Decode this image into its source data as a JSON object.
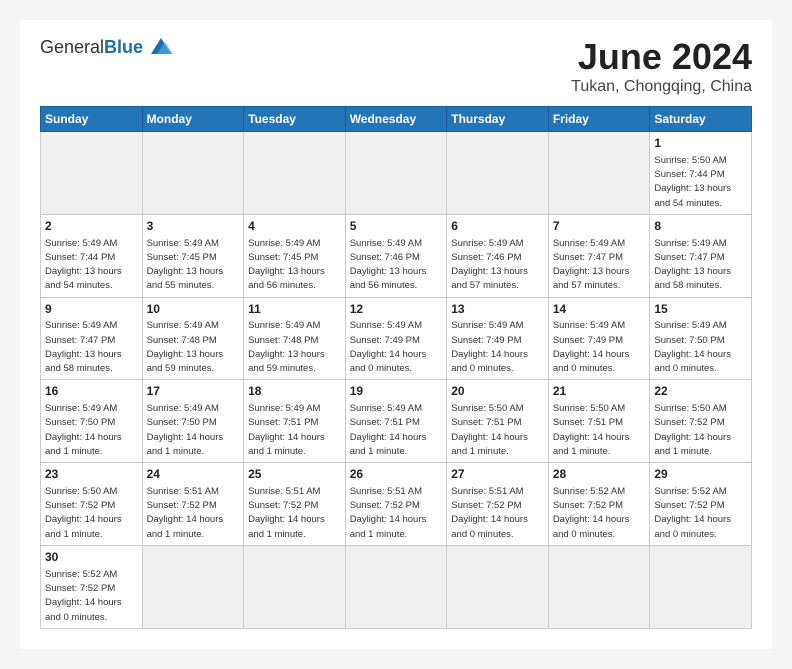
{
  "header": {
    "logo_general": "General",
    "logo_blue": "Blue",
    "title": "June 2024",
    "location": "Tukan, Chongqing, China"
  },
  "days_of_week": [
    "Sunday",
    "Monday",
    "Tuesday",
    "Wednesday",
    "Thursday",
    "Friday",
    "Saturday"
  ],
  "weeks": [
    [
      {
        "day": "",
        "empty": true
      },
      {
        "day": "",
        "empty": true
      },
      {
        "day": "",
        "empty": true
      },
      {
        "day": "",
        "empty": true
      },
      {
        "day": "",
        "empty": true
      },
      {
        "day": "",
        "empty": true
      },
      {
        "day": "1",
        "sunrise": "Sunrise: 5:50 AM",
        "sunset": "Sunset: 7:44 PM",
        "daylight": "Daylight: 13 hours and 54 minutes."
      }
    ],
    [
      {
        "day": "2",
        "sunrise": "Sunrise: 5:49 AM",
        "sunset": "Sunset: 7:44 PM",
        "daylight": "Daylight: 13 hours and 54 minutes."
      },
      {
        "day": "3",
        "sunrise": "Sunrise: 5:49 AM",
        "sunset": "Sunset: 7:45 PM",
        "daylight": "Daylight: 13 hours and 55 minutes."
      },
      {
        "day": "4",
        "sunrise": "Sunrise: 5:49 AM",
        "sunset": "Sunset: 7:45 PM",
        "daylight": "Daylight: 13 hours and 56 minutes."
      },
      {
        "day": "5",
        "sunrise": "Sunrise: 5:49 AM",
        "sunset": "Sunset: 7:46 PM",
        "daylight": "Daylight: 13 hours and 56 minutes."
      },
      {
        "day": "6",
        "sunrise": "Sunrise: 5:49 AM",
        "sunset": "Sunset: 7:46 PM",
        "daylight": "Daylight: 13 hours and 57 minutes."
      },
      {
        "day": "7",
        "sunrise": "Sunrise: 5:49 AM",
        "sunset": "Sunset: 7:47 PM",
        "daylight": "Daylight: 13 hours and 57 minutes."
      },
      {
        "day": "8",
        "sunrise": "Sunrise: 5:49 AM",
        "sunset": "Sunset: 7:47 PM",
        "daylight": "Daylight: 13 hours and 58 minutes."
      }
    ],
    [
      {
        "day": "9",
        "sunrise": "Sunrise: 5:49 AM",
        "sunset": "Sunset: 7:47 PM",
        "daylight": "Daylight: 13 hours and 58 minutes."
      },
      {
        "day": "10",
        "sunrise": "Sunrise: 5:49 AM",
        "sunset": "Sunset: 7:48 PM",
        "daylight": "Daylight: 13 hours and 59 minutes."
      },
      {
        "day": "11",
        "sunrise": "Sunrise: 5:49 AM",
        "sunset": "Sunset: 7:48 PM",
        "daylight": "Daylight: 13 hours and 59 minutes."
      },
      {
        "day": "12",
        "sunrise": "Sunrise: 5:49 AM",
        "sunset": "Sunset: 7:49 PM",
        "daylight": "Daylight: 14 hours and 0 minutes."
      },
      {
        "day": "13",
        "sunrise": "Sunrise: 5:49 AM",
        "sunset": "Sunset: 7:49 PM",
        "daylight": "Daylight: 14 hours and 0 minutes."
      },
      {
        "day": "14",
        "sunrise": "Sunrise: 5:49 AM",
        "sunset": "Sunset: 7:49 PM",
        "daylight": "Daylight: 14 hours and 0 minutes."
      },
      {
        "day": "15",
        "sunrise": "Sunrise: 5:49 AM",
        "sunset": "Sunset: 7:50 PM",
        "daylight": "Daylight: 14 hours and 0 minutes."
      }
    ],
    [
      {
        "day": "16",
        "sunrise": "Sunrise: 5:49 AM",
        "sunset": "Sunset: 7:50 PM",
        "daylight": "Daylight: 14 hours and 1 minute."
      },
      {
        "day": "17",
        "sunrise": "Sunrise: 5:49 AM",
        "sunset": "Sunset: 7:50 PM",
        "daylight": "Daylight: 14 hours and 1 minute."
      },
      {
        "day": "18",
        "sunrise": "Sunrise: 5:49 AM",
        "sunset": "Sunset: 7:51 PM",
        "daylight": "Daylight: 14 hours and 1 minute."
      },
      {
        "day": "19",
        "sunrise": "Sunrise: 5:49 AM",
        "sunset": "Sunset: 7:51 PM",
        "daylight": "Daylight: 14 hours and 1 minute."
      },
      {
        "day": "20",
        "sunrise": "Sunrise: 5:50 AM",
        "sunset": "Sunset: 7:51 PM",
        "daylight": "Daylight: 14 hours and 1 minute."
      },
      {
        "day": "21",
        "sunrise": "Sunrise: 5:50 AM",
        "sunset": "Sunset: 7:51 PM",
        "daylight": "Daylight: 14 hours and 1 minute."
      },
      {
        "day": "22",
        "sunrise": "Sunrise: 5:50 AM",
        "sunset": "Sunset: 7:52 PM",
        "daylight": "Daylight: 14 hours and 1 minute."
      }
    ],
    [
      {
        "day": "23",
        "sunrise": "Sunrise: 5:50 AM",
        "sunset": "Sunset: 7:52 PM",
        "daylight": "Daylight: 14 hours and 1 minute."
      },
      {
        "day": "24",
        "sunrise": "Sunrise: 5:51 AM",
        "sunset": "Sunset: 7:52 PM",
        "daylight": "Daylight: 14 hours and 1 minute."
      },
      {
        "day": "25",
        "sunrise": "Sunrise: 5:51 AM",
        "sunset": "Sunset: 7:52 PM",
        "daylight": "Daylight: 14 hours and 1 minute."
      },
      {
        "day": "26",
        "sunrise": "Sunrise: 5:51 AM",
        "sunset": "Sunset: 7:52 PM",
        "daylight": "Daylight: 14 hours and 1 minute."
      },
      {
        "day": "27",
        "sunrise": "Sunrise: 5:51 AM",
        "sunset": "Sunset: 7:52 PM",
        "daylight": "Daylight: 14 hours and 0 minutes."
      },
      {
        "day": "28",
        "sunrise": "Sunrise: 5:52 AM",
        "sunset": "Sunset: 7:52 PM",
        "daylight": "Daylight: 14 hours and 0 minutes."
      },
      {
        "day": "29",
        "sunrise": "Sunrise: 5:52 AM",
        "sunset": "Sunset: 7:52 PM",
        "daylight": "Daylight: 14 hours and 0 minutes."
      }
    ],
    [
      {
        "day": "30",
        "sunrise": "Sunrise: 5:52 AM",
        "sunset": "Sunset: 7:52 PM",
        "daylight": "Daylight: 14 hours and 0 minutes."
      },
      {
        "day": "",
        "empty": true
      },
      {
        "day": "",
        "empty": true
      },
      {
        "day": "",
        "empty": true
      },
      {
        "day": "",
        "empty": true
      },
      {
        "day": "",
        "empty": true
      },
      {
        "day": "",
        "empty": true
      }
    ]
  ]
}
